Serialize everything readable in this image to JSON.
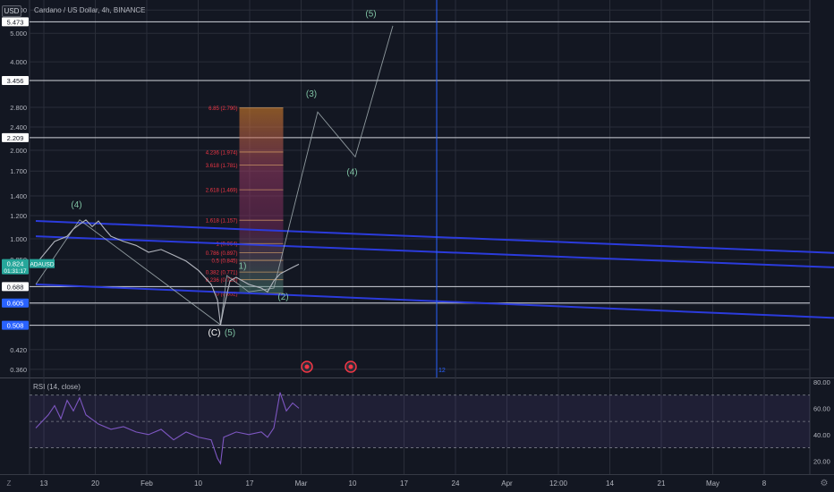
{
  "header": {
    "currency": "USD",
    "symbol_title": "Cardano / US Dollar, 4h, BINANCE"
  },
  "rsi": {
    "label": "RSI (14, close)",
    "ticks": [
      "80.00",
      "60.00",
      "40.00",
      "20.00"
    ]
  },
  "bottom_bar": {
    "timezone": "Z"
  },
  "colors": {
    "background": "#131722",
    "grid": "#2a2e39",
    "price": "#b2b5be",
    "trendline": "#2b3bdc",
    "wave": "#7fc2a3",
    "fib_text": "#f23645",
    "rsi": "#7e57c2",
    "live_price": "#26a69a",
    "marker": "#2962ff"
  },
  "chart_data": {
    "type": "line",
    "y_scale": "log",
    "ylim": [
      0.34,
      6.4
    ],
    "price_ticks": [
      "6.000",
      "5.000",
      "4.000",
      "2.800",
      "2.400",
      "2.000",
      "1.700",
      "1.400",
      "1.200",
      "1.000",
      "0.850",
      "0.600",
      "0.420",
      "0.360"
    ],
    "x_ticks": [
      "13",
      "20",
      "Feb",
      "10",
      "17",
      "Mar",
      "10",
      "17",
      "24",
      "Apr",
      "12:00",
      "14",
      "21",
      "May",
      "8"
    ],
    "price_series": [
      {
        "d": 0,
        "v": 0.82
      },
      {
        "d": 3,
        "v": 0.98
      },
      {
        "d": 5,
        "v": 1.02
      },
      {
        "d": 6,
        "v": 1.08
      },
      {
        "d": 7,
        "v": 1.12
      },
      {
        "d": 8,
        "v": 1.16
      },
      {
        "d": 9,
        "v": 1.1
      },
      {
        "d": 10,
        "v": 1.15
      },
      {
        "d": 11,
        "v": 1.08
      },
      {
        "d": 12,
        "v": 1.02
      },
      {
        "d": 14,
        "v": 0.98
      },
      {
        "d": 16,
        "v": 0.95
      },
      {
        "d": 18,
        "v": 0.9
      },
      {
        "d": 20,
        "v": 0.92
      },
      {
        "d": 22,
        "v": 0.88
      },
      {
        "d": 24,
        "v": 0.84
      },
      {
        "d": 26,
        "v": 0.78
      },
      {
        "d": 28,
        "v": 0.7
      },
      {
        "d": 29,
        "v": 0.62
      },
      {
        "d": 29.5,
        "v": 0.51
      },
      {
        "d": 30,
        "v": 0.58
      },
      {
        "d": 31,
        "v": 0.72
      },
      {
        "d": 32,
        "v": 0.74
      },
      {
        "d": 34,
        "v": 0.7
      },
      {
        "d": 36,
        "v": 0.68
      },
      {
        "d": 37,
        "v": 0.66
      },
      {
        "d": 38,
        "v": 0.72
      },
      {
        "d": 39,
        "v": 0.76
      },
      {
        "d": 40,
        "v": 0.78
      },
      {
        "d": 41,
        "v": 0.8
      },
      {
        "d": 42,
        "v": 0.82
      }
    ],
    "price_labels": [
      {
        "value": 5.473,
        "text": "5.473",
        "bg": "#ffffff",
        "fg": "#131722"
      },
      {
        "value": 3.456,
        "text": "3.456",
        "bg": "#ffffff",
        "fg": "#131722"
      },
      {
        "value": 2.209,
        "text": "2.209",
        "bg": "#ffffff",
        "fg": "#131722"
      },
      {
        "value": 0.824,
        "text": "0.824",
        "bg": "#26a69a",
        "fg": "#ffffff",
        "sub": "01:31:17"
      },
      {
        "value": 0.688,
        "text": "0.688",
        "bg": "#ffffff",
        "fg": "#131722"
      },
      {
        "value": 0.605,
        "text": "0.605",
        "bg": "#2962ff",
        "fg": "#ffffff"
      },
      {
        "value": 0.508,
        "text": "0.508",
        "bg": "#2962ff",
        "fg": "#ffffff"
      }
    ],
    "horizontal_levels": [
      5.473,
      3.456,
      2.209,
      0.688,
      0.605,
      0.508
    ],
    "live_tag": {
      "value": 0.824,
      "text": "ADAUSD"
    },
    "trendlines": [
      {
        "from": {
          "d": 0,
          "v": 1.15
        },
        "to": {
          "d": 154,
          "v": 0.85
        }
      },
      {
        "from": {
          "d": 0,
          "v": 1.02
        },
        "to": {
          "d": 154,
          "v": 0.76
        }
      },
      {
        "from": {
          "d": 0,
          "v": 0.7
        },
        "to": {
          "d": 154,
          "v": 0.51
        }
      }
    ],
    "wave_path": [
      {
        "d": 0,
        "v": 0.7
      },
      {
        "d": 7,
        "v": 1.16
      },
      {
        "d": 29.5,
        "v": 0.51
      },
      {
        "d": 30.5,
        "v": 0.75
      },
      {
        "d": 34,
        "v": 0.66
      },
      {
        "d": 38,
        "v": 0.68
      },
      {
        "d": 45,
        "v": 2.7
      },
      {
        "d": 51,
        "v": 1.9
      },
      {
        "d": 57,
        "v": 5.3
      }
    ],
    "wave_labels": [
      {
        "d": 6.5,
        "v": 1.28,
        "text": "(4)"
      },
      {
        "d": 28.5,
        "v": 0.47,
        "text": "(C)"
      },
      {
        "d": 31,
        "v": 0.47,
        "text": "(5)"
      },
      {
        "d": 33,
        "v": 0.79,
        "text": "1)"
      },
      {
        "d": 39.5,
        "v": 0.62,
        "text": "(2)"
      },
      {
        "d": 44,
        "v": 3.05,
        "text": "(3)"
      },
      {
        "d": 50.5,
        "v": 1.65,
        "text": "(4)"
      },
      {
        "d": 53.5,
        "v": 5.7,
        "text": "(5)"
      }
    ],
    "fib_zone": {
      "d_start": 32.5,
      "d_end": 39.5,
      "v_top": 2.79,
      "v_bottom": 0.652
    },
    "fib_levels": [
      {
        "v": 2.79,
        "text": "6.85 (2.790)"
      },
      {
        "v": 1.974,
        "text": "4.236 (1.974)"
      },
      {
        "v": 1.781,
        "text": "3.618 (1.781)"
      },
      {
        "v": 1.469,
        "text": "2.618 (1.469)"
      },
      {
        "v": 1.157,
        "text": "1.618 (1.157)"
      },
      {
        "v": 0.964,
        "text": "1 (0.964)"
      },
      {
        "v": 0.897,
        "text": "0.786 (0.897)"
      },
      {
        "v": 0.845,
        "text": "0.5 (0.845)"
      },
      {
        "v": 0.771,
        "text": "0.382 (0.771)"
      },
      {
        "v": 0.726,
        "text": "0.236 (0.726)"
      },
      {
        "v": 0.652,
        "text": "0 (0.652)"
      }
    ],
    "vertical_marker": {
      "d": 64,
      "label": "12"
    },
    "event_icons": [
      {
        "d": 43
      },
      {
        "d": 50
      }
    ],
    "rsi_series": [
      {
        "d": 0,
        "v": 45
      },
      {
        "d": 2,
        "v": 55
      },
      {
        "d": 3,
        "v": 62
      },
      {
        "d": 4,
        "v": 52
      },
      {
        "d": 5,
        "v": 66
      },
      {
        "d": 6,
        "v": 58
      },
      {
        "d": 7,
        "v": 68
      },
      {
        "d": 8,
        "v": 55
      },
      {
        "d": 10,
        "v": 48
      },
      {
        "d": 12,
        "v": 44
      },
      {
        "d": 14,
        "v": 46
      },
      {
        "d": 16,
        "v": 42
      },
      {
        "d": 18,
        "v": 40
      },
      {
        "d": 20,
        "v": 44
      },
      {
        "d": 22,
        "v": 36
      },
      {
        "d": 24,
        "v": 42
      },
      {
        "d": 26,
        "v": 38
      },
      {
        "d": 28,
        "v": 36
      },
      {
        "d": 29,
        "v": 22
      },
      {
        "d": 29.5,
        "v": 18
      },
      {
        "d": 30,
        "v": 38
      },
      {
        "d": 32,
        "v": 42
      },
      {
        "d": 34,
        "v": 40
      },
      {
        "d": 36,
        "v": 42
      },
      {
        "d": 37,
        "v": 38
      },
      {
        "d": 38,
        "v": 45
      },
      {
        "d": 39,
        "v": 72
      },
      {
        "d": 40,
        "v": 58
      },
      {
        "d": 41,
        "v": 64
      },
      {
        "d": 42,
        "v": 60
      }
    ],
    "rsi_ylim": [
      10,
      82
    ],
    "rsi_band": [
      30,
      70
    ]
  }
}
